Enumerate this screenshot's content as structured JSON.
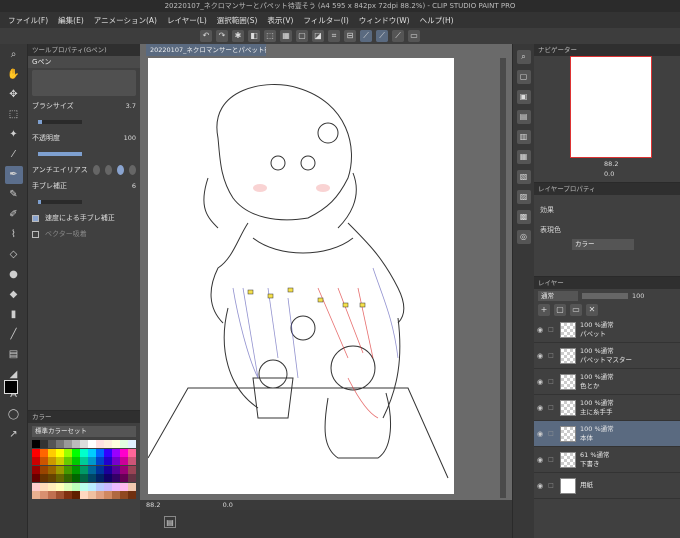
{
  "window": {
    "title": "20220107_ネクロマンサーとパペット待壹そう (A4 595 x 842px 72dpi 88.2%) - CLIP STUDIO PAINT PRO"
  },
  "menu": [
    "ファイル(F)",
    "編集(E)",
    "アニメーション(A)",
    "レイヤー(L)",
    "選択範囲(S)",
    "表示(V)",
    "フィルター(I)",
    "ウィンドウ(W)",
    "ヘルプ(H)"
  ],
  "tool_property": {
    "tab_label": "ツールプロパティ(Gペン)",
    "tool_name": "Gペン",
    "brush_size_label": "ブラシサイズ",
    "brush_size_value": "3.7",
    "brush_size_fraction": 0.08,
    "opacity_label": "不透明度",
    "opacity_value": "100",
    "opacity_fraction": 1.0,
    "antialias_label": "アンチエイリアス",
    "stabilization_label": "手ブレ補正",
    "stabilization_value": "6",
    "stabilization_fraction": 0.06,
    "speed_stabilization_label": "速度による手ブレ補正",
    "speed_stabilization_checked": true,
    "vector_snap_label": "ベクター吸着"
  },
  "color_set": {
    "tab_label": "カラー",
    "set_name": "標準カラーセット",
    "colors": [
      "#000000",
      "#333333",
      "#555555",
      "#777777",
      "#999999",
      "#bbbbbb",
      "#dddddd",
      "#ffffff",
      "#ffe0e0",
      "#ffeedd",
      "#ffffdd",
      "#e0ffe0",
      "#e0f0ff",
      "#ff0000",
      "#ff6600",
      "#ffcc00",
      "#ffff00",
      "#99ff00",
      "#00ff00",
      "#00ffcc",
      "#00ccff",
      "#0066ff",
      "#3300ff",
      "#9900ff",
      "#ff00cc",
      "#ff6699",
      "#cc0000",
      "#cc5500",
      "#cc9900",
      "#cccc00",
      "#66cc00",
      "#00cc00",
      "#00cc99",
      "#0099cc",
      "#0044cc",
      "#2200cc",
      "#7700cc",
      "#cc0099",
      "#cc5577",
      "#990000",
      "#994400",
      "#996600",
      "#999900",
      "#449900",
      "#009900",
      "#009966",
      "#006699",
      "#003399",
      "#1a0099",
      "#550099",
      "#990077",
      "#994455",
      "#660000",
      "#663300",
      "#664400",
      "#666600",
      "#336600",
      "#006600",
      "#006644",
      "#004466",
      "#002266",
      "#110066",
      "#330066",
      "#660055",
      "#663344",
      "#ffcccc",
      "#ffddbb",
      "#ffeebb",
      "#ffffbb",
      "#ddffbb",
      "#bbffbb",
      "#bbffee",
      "#bbeeff",
      "#bbccff",
      "#ccbbff",
      "#eebbff",
      "#ffbbee",
      "#f2c9b0",
      "#e8b090",
      "#d89070",
      "#c07050",
      "#a05030",
      "#803010",
      "#602000",
      "#ffd8c0",
      "#f0c0a0",
      "#e0a080",
      "#d08860",
      "#b06840",
      "#904820",
      "#703010"
    ]
  },
  "canvas": {
    "tab_label": "20220107_ネクロマンサーとパペット待壹そう",
    "zoom": "88.2",
    "angle": "0.0"
  },
  "navigator": {
    "tab_label": "ナビゲーター",
    "zoom": "88.2",
    "angle": "0.0"
  },
  "layer_property": {
    "tab_label": "レイヤープロパティ",
    "effect_label": "効果",
    "color_label": "表現色",
    "color_value": "カラー"
  },
  "layers": {
    "tab_label": "レイヤー",
    "blend_mode": "通常",
    "opacity": "100",
    "items": [
      {
        "mode": "100 %通常",
        "name": "パペット",
        "selected": false
      },
      {
        "mode": "100 %通常",
        "name": "パペットマスター",
        "selected": false
      },
      {
        "mode": "100 %通常",
        "name": "色とか",
        "selected": false
      },
      {
        "mode": "100 %通常",
        "name": "主に糸手手",
        "selected": false
      },
      {
        "mode": "100 %通常",
        "name": "本体",
        "selected": true
      },
      {
        "mode": "61 %通常",
        "name": "下書き",
        "selected": false
      },
      {
        "mode": "",
        "name": "用紙",
        "selected": false
      }
    ]
  },
  "icons": {
    "tools": [
      "zoom-icon",
      "hand-icon",
      "move-icon",
      "selection-icon",
      "lasso-icon",
      "eyedropper-icon",
      "pen-icon",
      "pencil-icon",
      "brush-icon",
      "airbrush-icon",
      "eraser-icon",
      "blend-icon",
      "fill-icon",
      "gradient-icon",
      "figure-icon",
      "frame-icon",
      "ruler-icon",
      "text-icon",
      "balloon-icon",
      "correction-icon"
    ]
  }
}
